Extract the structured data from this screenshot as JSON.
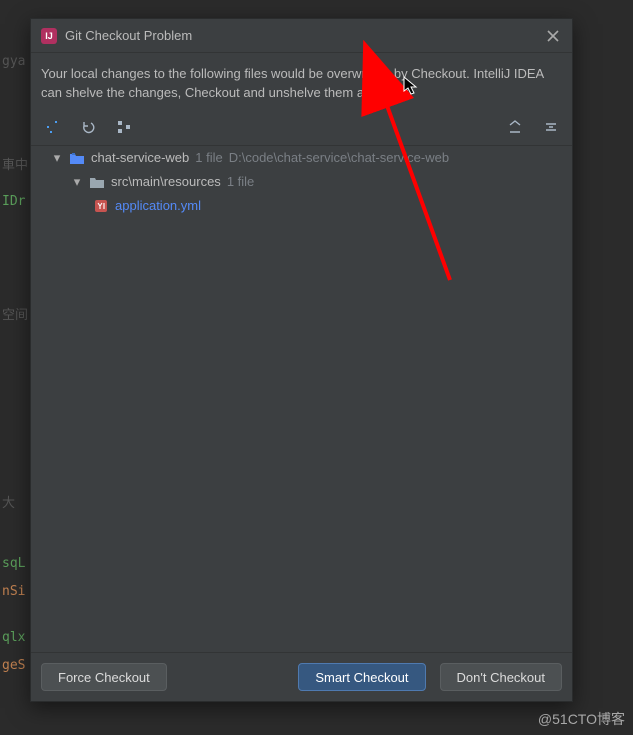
{
  "background_editor_fragments": [
    "gya",
    "車中",
    "IDr",
    "空间",
    "大",
    "sqL",
    "nSi",
    "qlx",
    "geS"
  ],
  "dialog": {
    "title": "Git Checkout Problem",
    "message": "Your local changes to the following files would be overwritten by Checkout. IntelliJ IDEA can shelve the changes, Checkout and unshelve them after that.",
    "toolbar_icons": {
      "magic": "magic-wand-icon",
      "undo": "undo-icon",
      "group": "group-by-icon",
      "expand": "expand-all-icon",
      "collapse": "collapse-all-icon"
    },
    "tree": {
      "root": {
        "name": "chat-service-web",
        "file_count": "1 file",
        "path": "D:\\code\\chat-service\\chat-service-web",
        "child": {
          "name": "src\\main\\resources",
          "file_count": "1 file",
          "file": "application.yml"
        }
      }
    },
    "buttons": {
      "force": "Force Checkout",
      "smart": "Smart Checkout",
      "dont": "Don't Checkout"
    }
  },
  "watermark": "@51CTO博客"
}
